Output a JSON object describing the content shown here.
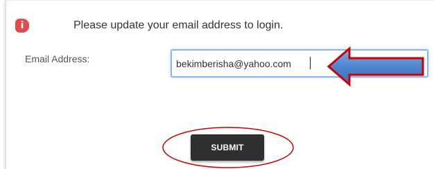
{
  "alert": {
    "icon": "info-icon",
    "icon_glyph": "i",
    "icon_color": "#e14b4b",
    "message": "Please update your email address to login."
  },
  "form": {
    "email_label": "Email Address:",
    "email_value": "bekimberisha@yahoo.com",
    "submit_label": "SUBMIT"
  },
  "annotations": {
    "arrow_color": "#4f86cf",
    "arrow_outline": "#cc0000",
    "highlight_circle_color": "#cc0000"
  }
}
